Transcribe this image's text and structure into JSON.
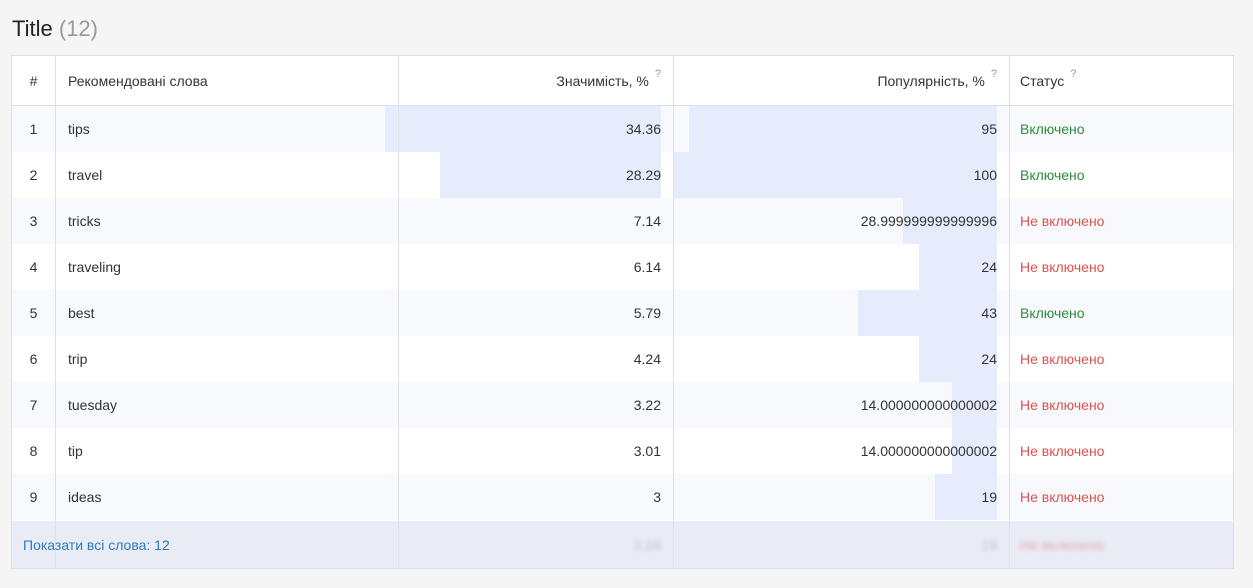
{
  "title": "Title",
  "count": "(12)",
  "columns": {
    "num": "#",
    "word": "Рекомендовані слова",
    "significance": "Значимість, %",
    "popularity": "Популярність, %",
    "status": "Статус"
  },
  "help_glyph": "?",
  "colors": {
    "bar": "#e6ecfb",
    "included": "#2e8b3e",
    "not_included": "#d9534f",
    "link": "#2a7bc0"
  },
  "rows": [
    {
      "num": "1",
      "word": "tips",
      "significance": "34.36",
      "popularity": "95",
      "status": "Включено",
      "included": true,
      "sig_fill": 0.3,
      "pop_fill": 0.95
    },
    {
      "num": "2",
      "word": "travel",
      "significance": "28.29",
      "popularity": "100",
      "status": "Включено",
      "included": true,
      "sig_fill": 0.24,
      "pop_fill": 1.0
    },
    {
      "num": "3",
      "word": "tricks",
      "significance": "7.14",
      "popularity": "28.999999999999996",
      "status": "Не включено",
      "included": false,
      "sig_fill": 0.0,
      "pop_fill": 0.29
    },
    {
      "num": "4",
      "word": "traveling",
      "significance": "6.14",
      "popularity": "24",
      "status": "Не включено",
      "included": false,
      "sig_fill": 0.0,
      "pop_fill": 0.24
    },
    {
      "num": "5",
      "word": "best",
      "significance": "5.79",
      "popularity": "43",
      "status": "Включено",
      "included": true,
      "sig_fill": 0.0,
      "pop_fill": 0.43
    },
    {
      "num": "6",
      "word": "trip",
      "significance": "4.24",
      "popularity": "24",
      "status": "Не включено",
      "included": false,
      "sig_fill": 0.0,
      "pop_fill": 0.24
    },
    {
      "num": "7",
      "word": "tuesday",
      "significance": "3.22",
      "popularity": "14.000000000000002",
      "status": "Не включено",
      "included": false,
      "sig_fill": 0.0,
      "pop_fill": 0.14
    },
    {
      "num": "8",
      "word": "tip",
      "significance": "3.01",
      "popularity": "14.000000000000002",
      "status": "Не включено",
      "included": false,
      "sig_fill": 0.0,
      "pop_fill": 0.14
    },
    {
      "num": "9",
      "word": "ideas",
      "significance": "3",
      "popularity": "19",
      "status": "Не включено",
      "included": false,
      "sig_fill": 0.0,
      "pop_fill": 0.19
    }
  ],
  "footer": {
    "show_all": "Показати всі слова: 12",
    "ghost_significance": "2.18",
    "ghost_popularity": "19",
    "ghost_status": "Не включено"
  }
}
